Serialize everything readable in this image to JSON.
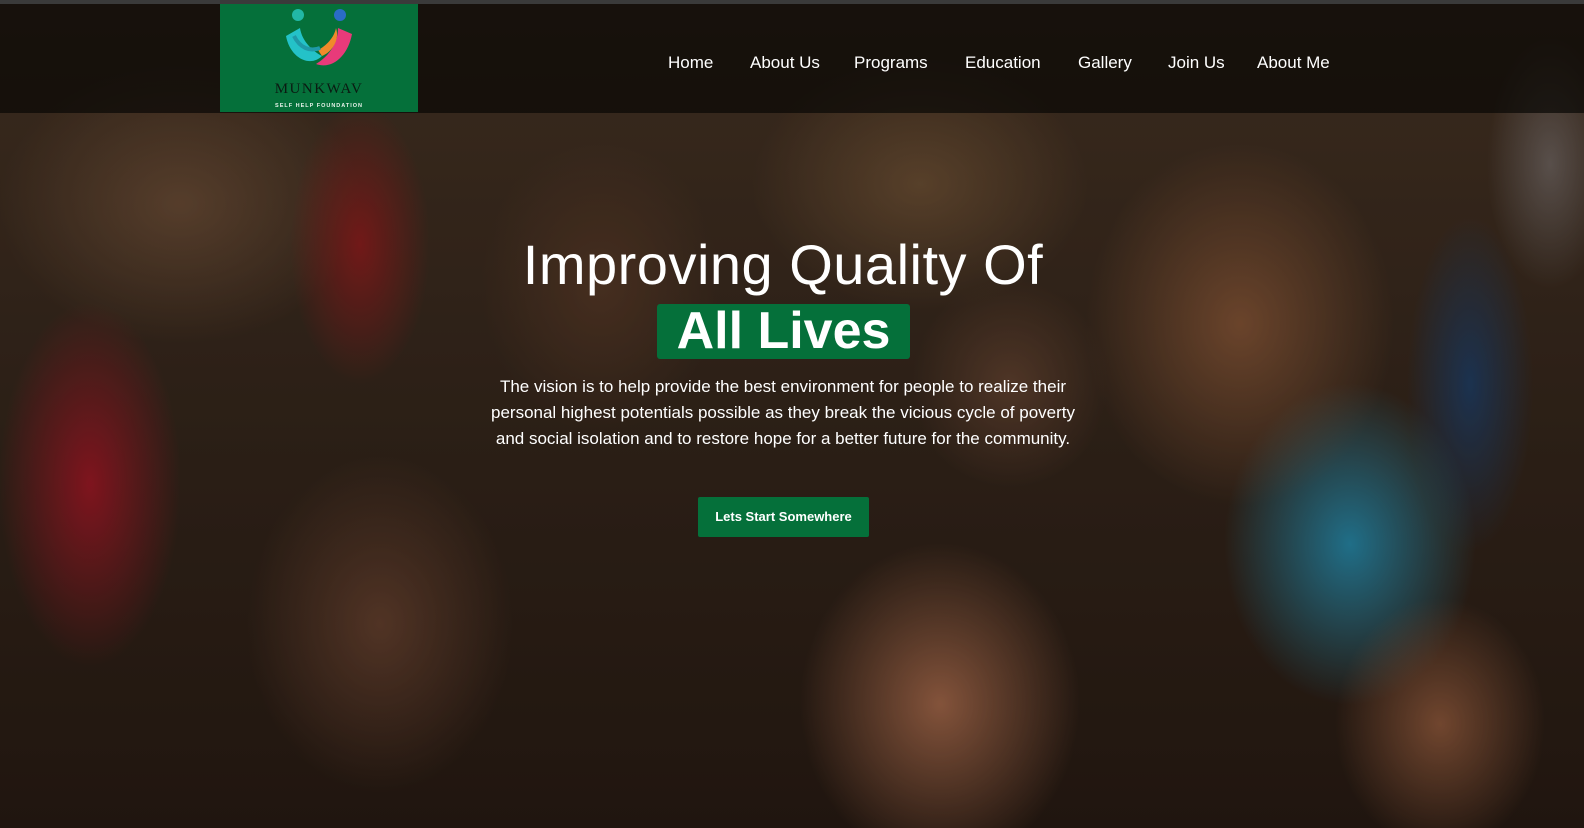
{
  "brand": {
    "name": "MUNKWAV",
    "tagline": "SELF HELP FOUNDATION",
    "accent_color": "#05703a"
  },
  "nav": {
    "items": [
      {
        "label": "Home"
      },
      {
        "label": "About Us"
      },
      {
        "label": "Programs"
      },
      {
        "label": "Education"
      },
      {
        "label": "Gallery"
      },
      {
        "label": "Join Us"
      },
      {
        "label": "About Me"
      }
    ]
  },
  "hero": {
    "title_line1": "Improving Quality Of",
    "title_highlight": "All Lives",
    "lead": "The vision is to help provide the best environment for people to realize their personal highest potentials possible as they break the vicious cycle of poverty and social isolation and to restore hope for a better future for the community.",
    "cta_label": "Lets Start Somewhere"
  }
}
